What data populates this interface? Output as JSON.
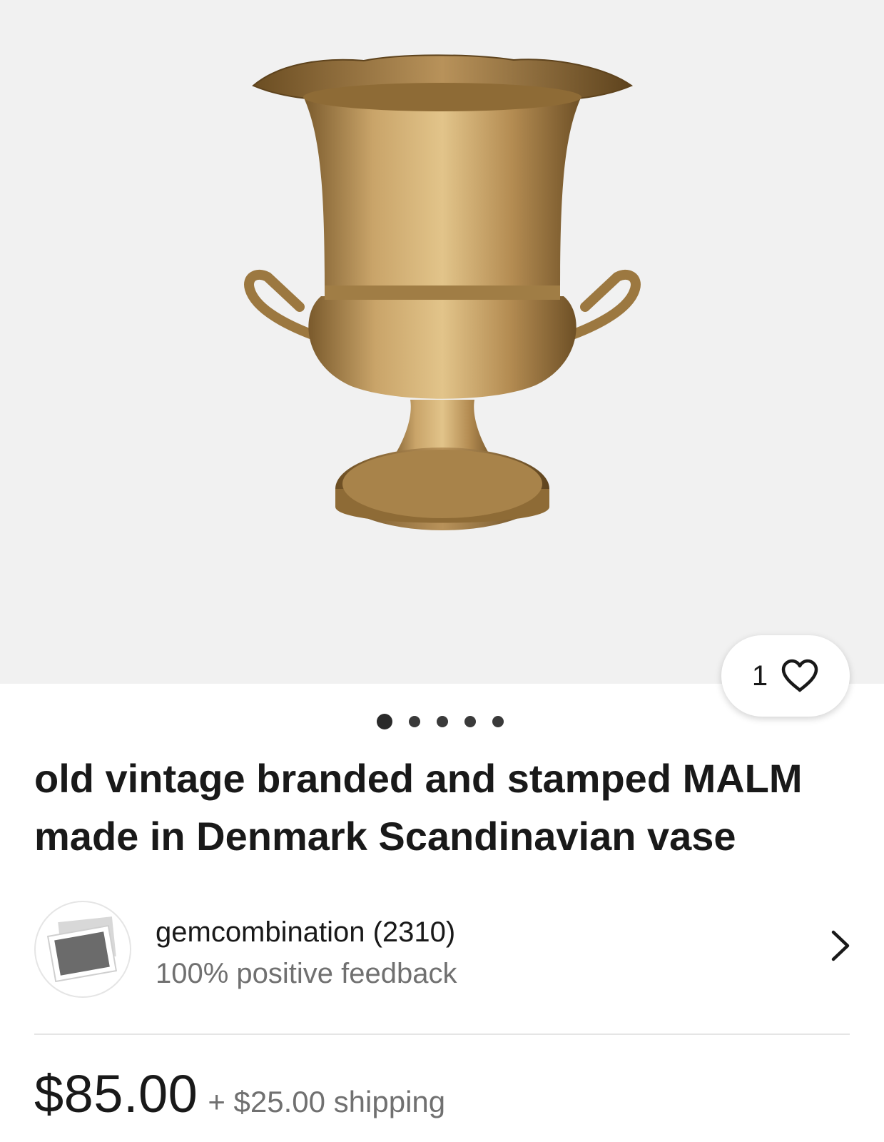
{
  "listing": {
    "title": "old vintage branded and stamped MALM made in Denmark Scandinavian vase",
    "watch_count": "1",
    "image_count": 5,
    "active_image_index": 0
  },
  "seller": {
    "name": "gemcombination (2310)",
    "feedback": "100% positive feedback"
  },
  "pricing": {
    "price": "$85.00",
    "shipping": "+ $25.00 shipping"
  },
  "icons": {
    "watch": "heart-icon",
    "seller_link": "chevron-right-icon",
    "avatar": "photo-placeholder-icon"
  },
  "colors": {
    "gallery_bg": "#f1f1f1",
    "text_primary": "#191919",
    "text_secondary": "#707070",
    "brass": "#b08a4e"
  }
}
